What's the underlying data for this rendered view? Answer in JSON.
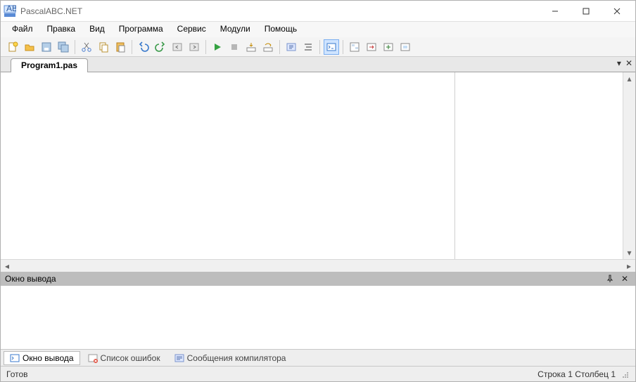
{
  "window": {
    "title": "PascalABC.NET"
  },
  "menu": {
    "items": [
      "Файл",
      "Правка",
      "Вид",
      "Программа",
      "Сервис",
      "Модули",
      "Помощь"
    ]
  },
  "toolbar": {
    "buttons": [
      "new",
      "open",
      "save",
      "save-all",
      "cut",
      "copy",
      "paste",
      "undo",
      "redo",
      "nav-back",
      "nav-fwd",
      "run",
      "stop",
      "step-into",
      "step-over",
      "compile",
      "format",
      "terminal",
      "form-designer",
      "convert",
      "exe",
      "msi"
    ]
  },
  "tabs": {
    "active": "Program1.pas"
  },
  "output_panel": {
    "title": "Окно вывода"
  },
  "bottom_tabs": {
    "items": [
      {
        "label": "Окно вывода",
        "active": true
      },
      {
        "label": "Список ошибок",
        "active": false
      },
      {
        "label": "Сообщения компилятора",
        "active": false
      }
    ]
  },
  "status": {
    "ready": "Готов",
    "line_label": "Строка",
    "line": "1",
    "col_label": "Столбец",
    "col": "1"
  }
}
